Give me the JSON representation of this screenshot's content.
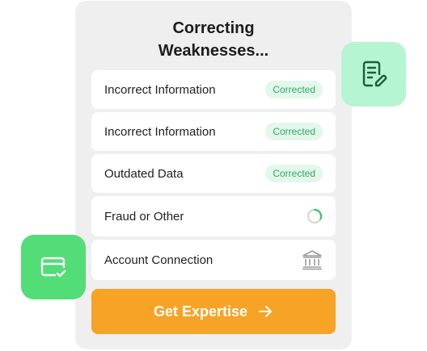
{
  "panel": {
    "title_line1": "Correcting",
    "title_line2": "Weaknesses..."
  },
  "rows": [
    {
      "label": "Incorrect Information",
      "status": "Corrected"
    },
    {
      "label": "Incorrect Information",
      "status": "Corrected"
    },
    {
      "label": "Outdated Data",
      "status": "Corrected"
    },
    {
      "label": "Fraud or Other",
      "status_icon": "loading-spinner-icon"
    },
    {
      "label": "Account Connection",
      "status_icon": "bank-icon"
    }
  ],
  "cta": {
    "label": "Get Expertise",
    "icon": "arrow-right-icon"
  },
  "floating_icons": {
    "right": {
      "icon": "document-edit-icon",
      "color": "#b5f5d2"
    },
    "left": {
      "icon": "card-check-icon",
      "color": "#52dd77"
    }
  },
  "colors": {
    "accent": "#f7a325",
    "success_text": "#2fa86a",
    "success_bg": "#e3f7ea",
    "panel_bg": "#efefef"
  }
}
